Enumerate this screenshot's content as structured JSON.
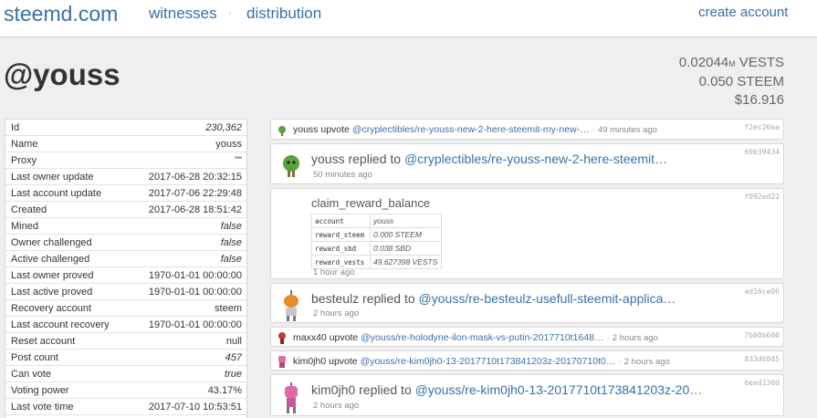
{
  "nav": {
    "brand": "steemd.com",
    "witnesses": "witnesses",
    "separator": "·",
    "distribution": "distribution",
    "create_account": "create account"
  },
  "account": {
    "username": "@youss",
    "vests_value": "0.02044",
    "vests_sub": "M",
    "vests_unit": " VESTS",
    "steem": "0.050 STEEM",
    "usd": "$16.916"
  },
  "properties": [
    {
      "key": "Id",
      "value": "230,362",
      "italic": true
    },
    {
      "key": "Name",
      "value": "youss",
      "italic": false
    },
    {
      "key": "Proxy",
      "value": "\"\"",
      "italic": false
    },
    {
      "key": "Last owner update",
      "value": "2017-06-28 20:32:15",
      "italic": false
    },
    {
      "key": "Last account update",
      "value": "2017-07-06 22:29:48",
      "italic": false
    },
    {
      "key": "Created",
      "value": "2017-06-28 18:51:42",
      "italic": false
    },
    {
      "key": "Mined",
      "value": "false",
      "italic": true
    },
    {
      "key": "Owner challenged",
      "value": "false",
      "italic": true
    },
    {
      "key": "Active challenged",
      "value": "false",
      "italic": true
    },
    {
      "key": "Last owner proved",
      "value": "1970-01-01 00:00:00",
      "italic": false
    },
    {
      "key": "Last active proved",
      "value": "1970-01-01 00:00:00",
      "italic": false
    },
    {
      "key": "Recovery account",
      "value": "steem",
      "italic": false
    },
    {
      "key": "Last account recovery",
      "value": "1970-01-01 00:00:00",
      "italic": false
    },
    {
      "key": "Reset account",
      "value": "null",
      "italic": false
    },
    {
      "key": "Post count",
      "value": "457",
      "italic": true
    },
    {
      "key": "Can vote",
      "value": "true",
      "italic": true
    },
    {
      "key": "Voting power",
      "value": "43.17%",
      "italic": false
    },
    {
      "key": "Last vote time",
      "value": "2017-07-10 10:53:51",
      "italic": false
    }
  ],
  "feed": {
    "item0": {
      "who": "youss",
      "action": "upvote",
      "link": "@cryplectibles/re-youss-new-2-here-steemit-my-new-…",
      "sep": "·",
      "time": "49 minutes ago",
      "hash": "f2ec20ea"
    },
    "item1": {
      "who": "youss",
      "action": "replied to",
      "link": "@cryplectibles/re-youss-new-2-here-steemit…",
      "time": "50 minutes ago",
      "hash": "69b39434"
    },
    "item2": {
      "title": "claim_reward_balance",
      "hash": "f092ed22",
      "rows": [
        {
          "k": "account",
          "v": "youss"
        },
        {
          "k": "reward_steem",
          "v": "0.000 STEEM"
        },
        {
          "k": "reward_sbd",
          "v": "0.038 SBD"
        },
        {
          "k": "reward_vests",
          "v": "49.627398 VESTS"
        }
      ],
      "time": "1 hour ago"
    },
    "item3": {
      "who": "besteulz",
      "action": "replied to",
      "link": "@youss/re-besteulz-usefull-steemit-applica…",
      "time": "2 hours ago",
      "hash": "ad16ce06"
    },
    "item4": {
      "who": "maxx40",
      "action": "upvote",
      "link": "@youss/re-holodyne-ilon-mask-vs-putin-2017710t1648…",
      "sep": "·",
      "time": "2 hours ago",
      "hash": "7b00b600"
    },
    "item5": {
      "who": "kim0jh0",
      "action": "upvote",
      "link": "@youss/re-kim0jh0-13-2017710t173841203z-20170710t0…",
      "sep": "·",
      "time": "2 hours ago",
      "hash": "833d6845"
    },
    "item6": {
      "who": "kim0jh0",
      "action": "replied to",
      "link": "@youss/re-kim0jh0-13-2017710t173841203z-20…",
      "time": "2 hours ago",
      "hash": "6eed130d"
    }
  },
  "colors": {
    "link": "#3a6fa8",
    "background": "#efefef"
  }
}
